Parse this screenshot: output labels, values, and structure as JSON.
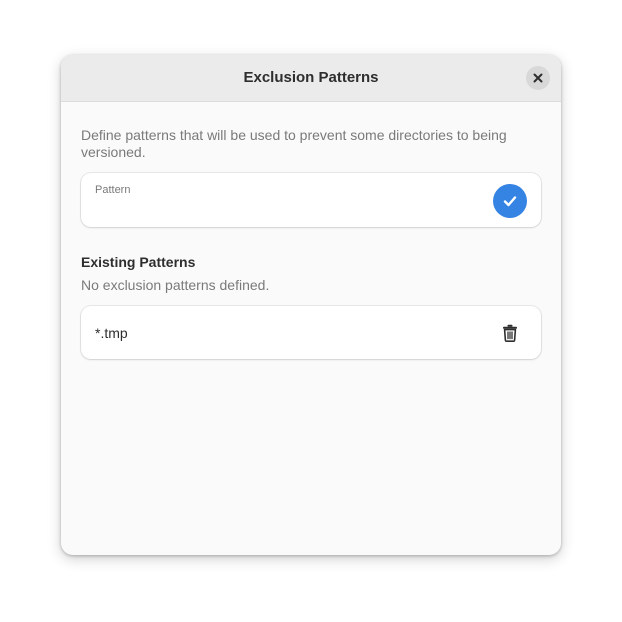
{
  "dialog": {
    "title": "Exclusion Patterns",
    "close_icon": "close-icon",
    "description": "Define patterns that will be used to prevent some directories to being versioned."
  },
  "entry": {
    "label": "Pattern",
    "value": "",
    "apply_icon": "checkmark-icon"
  },
  "existing": {
    "heading": "Existing Patterns",
    "empty_message": "No exclusion patterns defined.",
    "items": [
      {
        "pattern": "*.tmp",
        "action_icon": "trash-icon"
      }
    ]
  },
  "colors": {
    "accent": "#3584e4",
    "headerbar": "#ebebeb",
    "window_bg": "#fafafa",
    "card_bg": "#ffffff",
    "dim_text": "#7a7a7a",
    "text": "#2e2e2e"
  }
}
